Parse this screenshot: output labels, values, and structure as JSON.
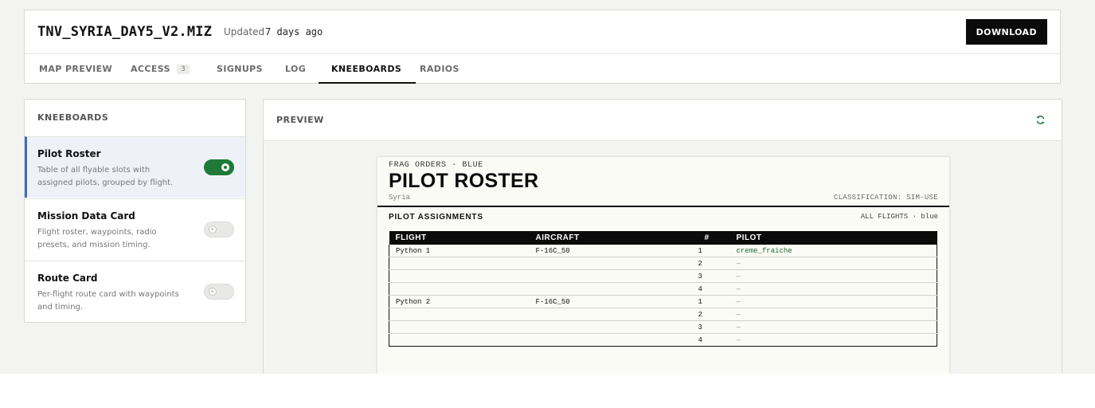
{
  "header": {
    "file_name": "TNV_SYRIA_DAY5_V2.MIZ",
    "updated_label": "Updated",
    "updated_value": "7 days ago",
    "download_label": "DOWNLOAD"
  },
  "tabs": [
    {
      "label": "MAP PREVIEW"
    },
    {
      "label": "ACCESS",
      "badge": "3"
    },
    {
      "label": "SIGNUPS"
    },
    {
      "label": "LOG"
    },
    {
      "label": "KNEEBOARDS",
      "active": true
    },
    {
      "label": "RADIOS"
    }
  ],
  "kneeboards": {
    "header": "KNEEBOARDS",
    "items": [
      {
        "name": "Pilot Roster",
        "description": "Table of all flyable slots with assigned pilots, grouped by flight.",
        "enabled": true,
        "selected": true
      },
      {
        "name": "Mission Data Card",
        "description": "Flight roster, waypoints, radio presets, and mission timing.",
        "enabled": false,
        "selected": false
      },
      {
        "name": "Route Card",
        "description": "Per-flight route card with waypoints and timing.",
        "enabled": false,
        "selected": false
      }
    ]
  },
  "preview": {
    "title": "PREVIEW",
    "refresh_icon": "refresh-icon",
    "colors": {
      "toggle_on": "#1e7a36",
      "selected_accent": "#3b6fb6",
      "pilot_assigned": "#1e6b2e"
    },
    "paper": {
      "kicker": "FRAG ORDERS · BLUE",
      "title": "PILOT ROSTER",
      "theatre": "Syria",
      "classification": "CLASSIFICATION: SIM-USE",
      "section_title": "PILOT ASSIGNMENTS",
      "section_meta": "ALL FLIGHTS · blue",
      "columns": [
        "FLIGHT",
        "AIRCRAFT",
        "#",
        "PILOT"
      ],
      "rows": [
        {
          "flight": "Python 1",
          "aircraft": "F-16C_50",
          "slot": "1",
          "pilot": "creme_fraiche",
          "group_start": true
        },
        {
          "flight": "",
          "aircraft": "",
          "slot": "2",
          "pilot": "—"
        },
        {
          "flight": "",
          "aircraft": "",
          "slot": "3",
          "pilot": "—"
        },
        {
          "flight": "",
          "aircraft": "",
          "slot": "4",
          "pilot": "—"
        },
        {
          "flight": "Python 2",
          "aircraft": "F-16C_50",
          "slot": "1",
          "pilot": "—",
          "group_start": true
        },
        {
          "flight": "",
          "aircraft": "",
          "slot": "2",
          "pilot": "—"
        },
        {
          "flight": "",
          "aircraft": "",
          "slot": "3",
          "pilot": "—"
        },
        {
          "flight": "",
          "aircraft": "",
          "slot": "4",
          "pilot": "—"
        }
      ]
    }
  }
}
